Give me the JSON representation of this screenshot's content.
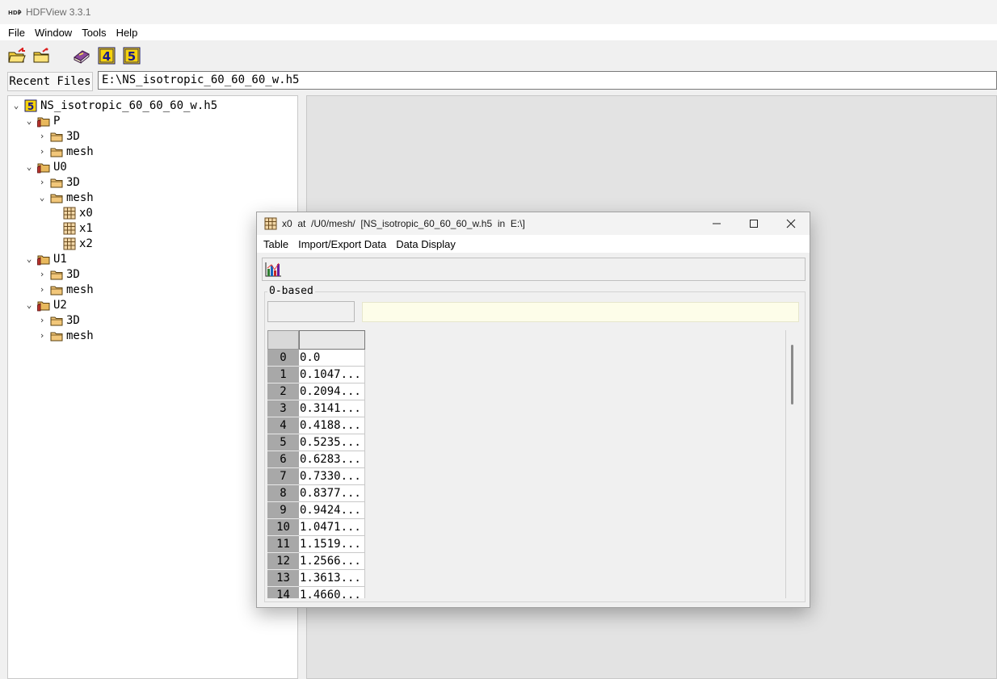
{
  "app": {
    "title": "HDFView 3.3.1",
    "logo": "hdf-logo"
  },
  "menubar": {
    "items": [
      "File",
      "Window",
      "Tools",
      "Help"
    ]
  },
  "toolbar": {
    "buttons": [
      "open-file-icon",
      "open-readonly-icon",
      "help-book-icon",
      "hdf4-library-icon",
      "hdf5-library-icon"
    ]
  },
  "recent": {
    "label": "Recent Files",
    "path": "E:\\NS_isotropic_60_60_60_w.h5"
  },
  "tree": {
    "file": "NS_isotropic_60_60_60_w.h5",
    "groups": [
      {
        "name": "P",
        "children": [
          "3D",
          "mesh"
        ]
      },
      {
        "name": "U0",
        "children": [
          "3D",
          "mesh"
        ],
        "mesh_datasets": [
          "x0",
          "x1",
          "x2"
        ]
      },
      {
        "name": "U1",
        "children": [
          "3D",
          "mesh"
        ]
      },
      {
        "name": "U2",
        "children": [
          "3D",
          "mesh"
        ]
      }
    ]
  },
  "dataset_window": {
    "title": "x0  at  /U0/mesh/  [NS_isotropic_60_60_60_w.h5  in  E:\\]",
    "menu": [
      "Table",
      "Import/Export Data",
      "Data Display"
    ],
    "index_base": "0-based",
    "cell_location": "",
    "cell_value": "",
    "column_header": "",
    "rows": [
      {
        "index": "0",
        "value": "0.0"
      },
      {
        "index": "1",
        "value": "0.1047..."
      },
      {
        "index": "2",
        "value": "0.2094..."
      },
      {
        "index": "3",
        "value": "0.3141..."
      },
      {
        "index": "4",
        "value": "0.4188..."
      },
      {
        "index": "5",
        "value": "0.5235..."
      },
      {
        "index": "6",
        "value": "0.6283..."
      },
      {
        "index": "7",
        "value": "0.7330..."
      },
      {
        "index": "8",
        "value": "0.8377..."
      },
      {
        "index": "9",
        "value": "0.9424..."
      },
      {
        "index": "10",
        "value": "1.0471..."
      },
      {
        "index": "11",
        "value": "1.1519..."
      },
      {
        "index": "12",
        "value": "1.2566..."
      },
      {
        "index": "13",
        "value": "1.3613..."
      },
      {
        "index": "14",
        "value": "1.4660..."
      }
    ]
  },
  "colors": {
    "accent": "#e8c000",
    "folder": "#e8b85c",
    "group_folder": "#a53a2a",
    "cell_value_bg": "#fdfde9"
  }
}
